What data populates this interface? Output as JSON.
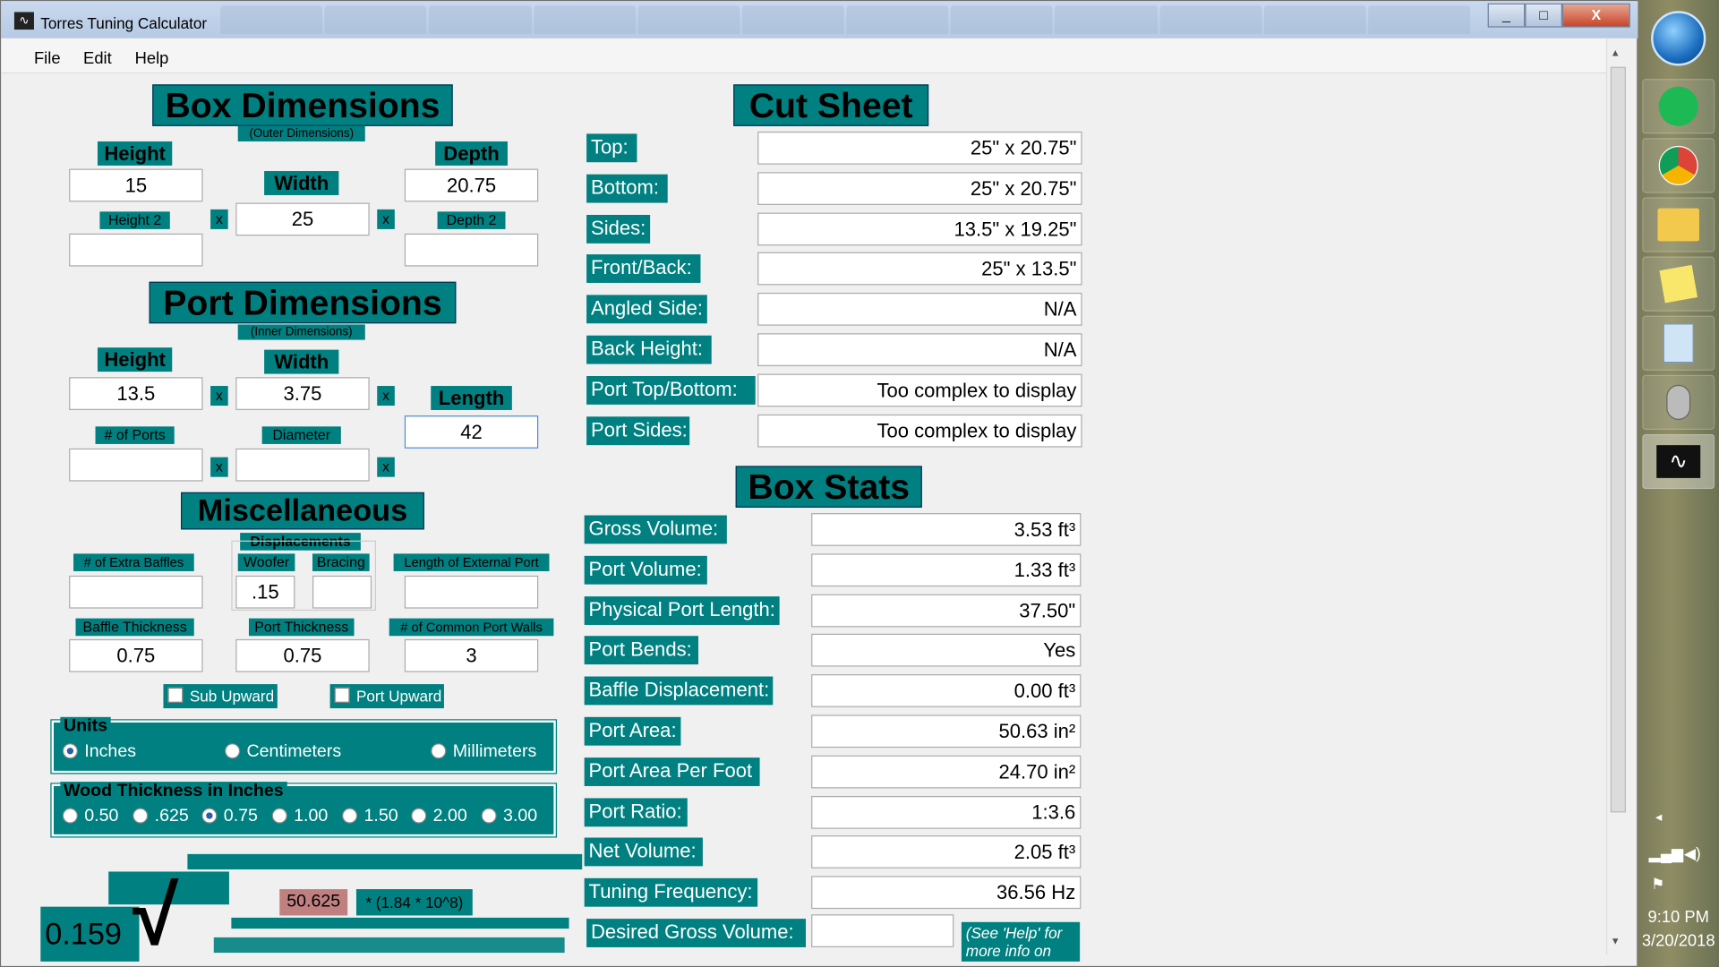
{
  "window": {
    "title": "Torres Tuning Calculator",
    "app_icon": "waveform-icon",
    "minimize": "_",
    "maximize": "□",
    "close": "X"
  },
  "menu": {
    "file": "File",
    "edit": "Edit",
    "help": "Help"
  },
  "box": {
    "title": "Box Dimensions",
    "subtitle": "(Outer Dimensions)",
    "height_label": "Height",
    "width_label": "Width",
    "depth_label": "Depth",
    "height2_label": "Height 2",
    "depth2_label": "Depth 2",
    "height": "15",
    "width": "25",
    "depth": "20.75",
    "height2": "",
    "depth2": "",
    "x": "x"
  },
  "port": {
    "title": "Port Dimensions",
    "subtitle": "(Inner Dimensions)",
    "height_label": "Height",
    "width_label": "Width",
    "length_label": "Length",
    "ports_label": "# of Ports",
    "diameter_label": "Diameter",
    "height": "13.5",
    "width": "3.75",
    "length": "42",
    "ports": "",
    "diameter": ""
  },
  "misc": {
    "title": "Miscellaneous",
    "extra_baffles_label": "# of Extra Baffles",
    "displacements_label": "Displacements",
    "woofer_label": "Woofer",
    "bracing_label": "Bracing",
    "ext_port_label": "Length of External Port",
    "extra_baffles": "",
    "woofer": ".15",
    "bracing": "",
    "ext_port": "",
    "baffle_thickness_label": "Baffle Thickness",
    "port_thickness_label": "Port Thickness",
    "common_walls_label": "# of Common Port Walls",
    "baffle_thickness": "0.75",
    "port_thickness": "0.75",
    "common_walls": "3",
    "sub_upward": "Sub Upward",
    "port_upward": "Port Upward"
  },
  "units": {
    "title": "Units",
    "options": [
      "Inches",
      "Centimeters",
      "Millimeters"
    ],
    "selected": "Inches"
  },
  "wood": {
    "title": "Wood Thickness in Inches",
    "options": [
      "0.50",
      ".625",
      "0.75",
      "1.00",
      "1.50",
      "2.00",
      "3.00"
    ],
    "selected": "0.75"
  },
  "formula": {
    "constant": "0.159",
    "area": "50.625",
    "factor": "* (1.84 * 10^8)"
  },
  "cut": {
    "title": "Cut Sheet",
    "rows": [
      {
        "label": "Top:",
        "value": "25\" x 20.75\""
      },
      {
        "label": "Bottom:",
        "value": "25\" x 20.75\""
      },
      {
        "label": "Sides:",
        "value": "13.5\" x 19.25\""
      },
      {
        "label": "Front/Back:",
        "value": "25\" x 13.5\""
      },
      {
        "label": "Angled Side:",
        "value": "N/A"
      },
      {
        "label": "Back Height:",
        "value": "N/A"
      },
      {
        "label": "Port Top/Bottom:",
        "value": "Too complex to display"
      },
      {
        "label": "Port Sides:",
        "value": "Too complex to display"
      }
    ]
  },
  "stats": {
    "title": "Box Stats",
    "rows": [
      {
        "label": "Gross Volume:",
        "value": "3.53 ft³"
      },
      {
        "label": "Port Volume:",
        "value": "1.33 ft³"
      },
      {
        "label": "Physical Port Length:",
        "value": "37.50\""
      },
      {
        "label": "Port Bends:",
        "value": "Yes"
      },
      {
        "label": "Baffle Displacement:",
        "value": "0.00 ft³"
      },
      {
        "label": "Port Area:",
        "value": "50.63 in²"
      },
      {
        "label": "Port Area Per Foot",
        "value": "24.70 in²"
      },
      {
        "label": "Port Ratio:",
        "value": "1:3.6"
      },
      {
        "label": "Net Volume:",
        "value": "2.05 ft³"
      },
      {
        "label": "Tuning Frequency:",
        "value": "36.56 Hz"
      }
    ],
    "desired_label": "Desired Gross Volume:",
    "desired_value": "",
    "note": "(See 'Help' for more info on"
  },
  "taskbar": {
    "time": "9:10 PM",
    "date": "3/20/2018"
  }
}
